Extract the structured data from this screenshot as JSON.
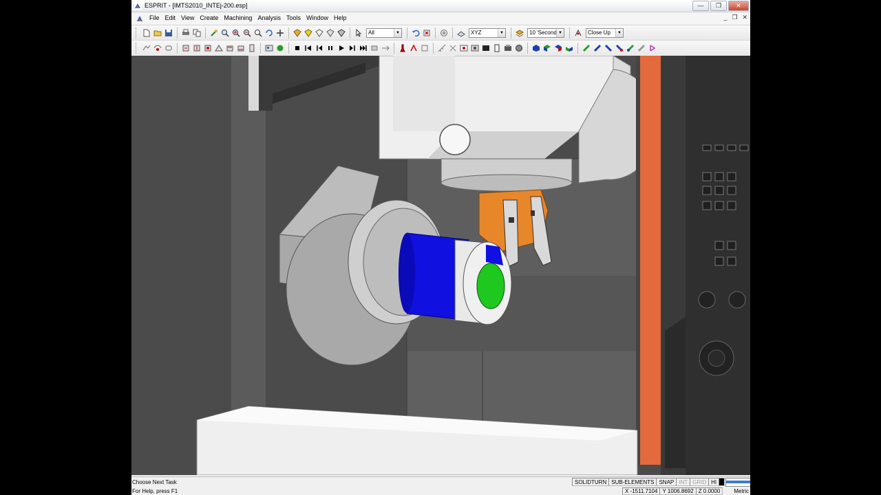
{
  "window": {
    "title": "ESPRIT - [IMTS2010_INTEj-200.esp]",
    "controls": {
      "minimize": "—",
      "maximize": "❐",
      "close": "✕"
    }
  },
  "menu": {
    "items": [
      "File",
      "Edit",
      "View",
      "Create",
      "Machining",
      "Analysis",
      "Tools",
      "Window",
      "Help"
    ],
    "mdi_controls": {
      "minimize": "_",
      "restore": "❐",
      "close": "✕"
    }
  },
  "toolbar": {
    "selection_filter": "All",
    "plane": "XYZ",
    "layer": "10 'Second",
    "view": "Close Up"
  },
  "status": {
    "message": "Choose Next Task",
    "help": "For Help, press F1",
    "indicators": {
      "solidturn": "SOLIDTURN",
      "sub_elements": "SUB-ELEMENTS",
      "snap": "SNAP",
      "int": "INT",
      "grid": "GRID",
      "hi": "HI"
    },
    "progress_fraction": 0.95,
    "coords": {
      "x": "X -1511.7104",
      "y": "Y 1006.8692",
      "z": "Z 0.0000"
    },
    "units": "Metric"
  },
  "colors": {
    "part_blue": "#1010e0",
    "part_green": "#1ec81e",
    "tool_orange": "#e8862a",
    "door_orange": "#e36a3c",
    "progress_blue": "#3a7bd5"
  }
}
